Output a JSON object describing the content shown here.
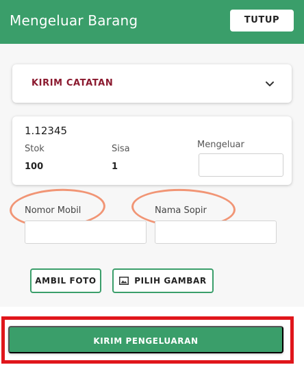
{
  "header": {
    "title": "Mengeluar Barang",
    "close_label": "TUTUP"
  },
  "notes_panel": {
    "label": "KIRIM CATATAN",
    "icon": "chevron-down-icon"
  },
  "item": {
    "code": "1.12345",
    "stok_label": "Stok",
    "stok_value": "100",
    "sisa_label": "Sisa",
    "sisa_value": "1",
    "mengeluar_label": "Mengeluar",
    "mengeluar_value": ""
  },
  "form": {
    "nomor_mobil_label": "Nomor Mobil",
    "nomor_mobil_value": "",
    "nama_sopir_label": "Nama Sopir",
    "nama_sopir_value": ""
  },
  "actions": {
    "ambil_foto_label": "AMBIL FOTO",
    "pilih_gambar_label": "PILIH GAMBAR",
    "pilih_gambar_icon": "image-icon",
    "kirim_label": "KIRIM PENGELUARAN"
  },
  "colors": {
    "brand_green": "#3a9e6a",
    "notes_label": "#8b1a2f",
    "highlight_red": "#e0161b",
    "annotation_orange": "#f08a66"
  }
}
